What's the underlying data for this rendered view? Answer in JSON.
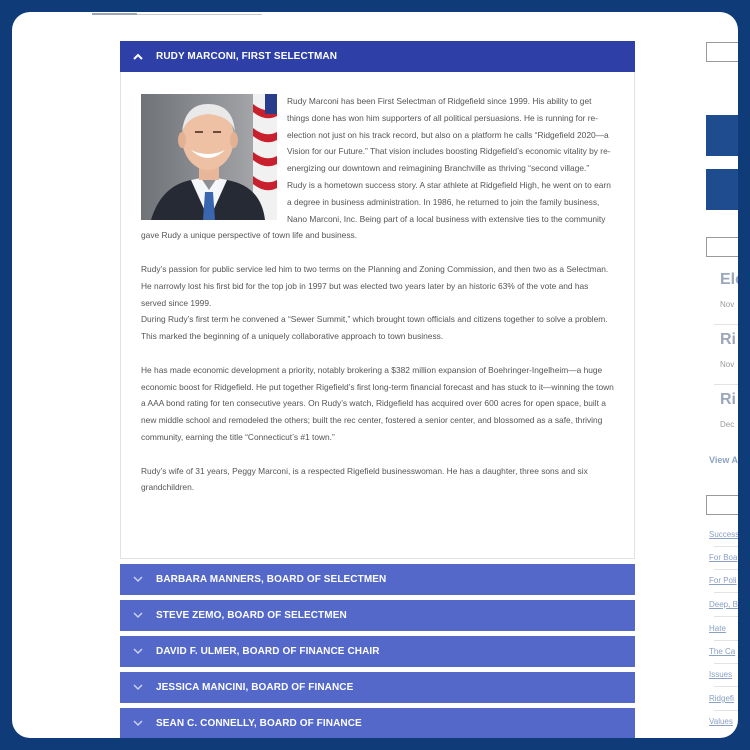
{
  "accordion": {
    "open_item": {
      "title": "RUDY MARCONI, FIRST SELECTMAN",
      "paragraphs": [
        "Rudy Marconi has been First Selectman of Ridgefield since 1999. His ability to get things done has won him supporters of all political persuasions. He is running for re-election not just on his track record, but also on a platform he calls “Ridgefield 2020—a Vision for our Future.” That vision includes boosting Ridgefield’s economic vitality by re-energizing our downtown and reimagining Branchville as thriving “second village.”",
        "Rudy is a hometown success story. A star athlete at Ridgefield High, he went on to earn a degree in business administration. In 1986, he returned to join the family business, Nano Marconi, Inc. Being part of a local business with extensive ties to the community gave Rudy a unique perspective of town life and business.",
        "Rudy’s passion for public service led him to two terms on the Planning and Zoning Commission, and then two as a Selectman. He narrowly lost his first bid for the top job in 1997 but was elected two years later by an historic 63% of the vote and has served since 1999.",
        "During Rudy’s first term he convened a “Sewer Summit,” which brought town officials and citizens together to solve a problem. This marked the beginning of a uniquely collaborative approach to town business.",
        "He has made economic development a priority, notably brokering a $382 million expansion of Boehringer-Ingelheim—a huge economic boost for Ridgefield.  He put together Rigefield’s first long-term financial forecast and has stuck to it—winning the town a AAA bond rating for ten consecutive years. On Rudy’s watch, Ridgefield has acquired over 600 acres for open space, built a new middle school and remodeled the others; built the rec center, fostered a senior center, and blossomed as a safe, thriving community, earning the title “Connecticut’s #1 town.”",
        "Rudy’s wife of 31 years, Peggy Marconi, is a respected Rigefield businesswoman. He has a daughter, three sons and six grandchildren."
      ]
    },
    "collapsed_items": [
      "BARBARA MANNERS, BOARD OF SELECTMEN",
      "STEVE ZEMO, BOARD OF SELECTMEN",
      "DAVID F. ULMER, BOARD OF FINANCE CHAIR",
      "JESSICA MANCINI, BOARD OF FINANCE",
      "SEAN C. CONNELLY, BOARD OF FINANCE"
    ]
  },
  "sidebar": {
    "posts": [
      {
        "title": "Ele",
        "date": "Nov"
      },
      {
        "title": "Ri",
        "date": "Nov"
      },
      {
        "title": "Ri",
        "date": "Dec"
      }
    ],
    "view_all": "View A",
    "categories": [
      "Success",
      "For Boa",
      "For Poli",
      "Deep, B",
      "Hate",
      "The Ca",
      "Issues",
      "Ridgefi",
      "Values"
    ]
  },
  "icons": {
    "open_chevron": "chevron-up-icon",
    "closed_chevron": "chevron-down-icon"
  },
  "colors": {
    "page_background": "#0f3b78",
    "accordion_open": "#2e3fa8",
    "accordion_closed": "#5468c9",
    "sidebar_bar": "#1e4c8f"
  }
}
